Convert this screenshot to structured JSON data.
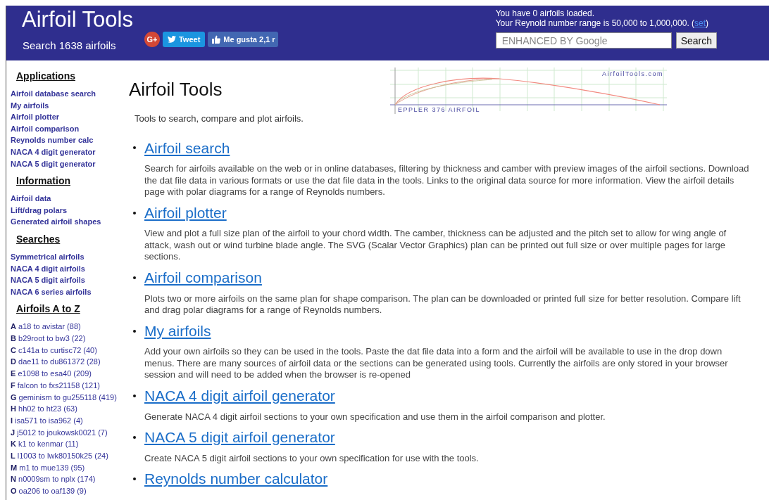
{
  "header": {
    "title": "Airfoil Tools",
    "subtitle": "Search 1638 airfoils",
    "social": [
      {
        "kind": "gplus",
        "label": "G+"
      },
      {
        "kind": "tweet",
        "label": "Tweet"
      },
      {
        "kind": "like",
        "label": "Me gusta 2,1 r"
      }
    ],
    "status_lines": [
      "You have 0 airfoils loaded.",
      "Your Reynold number range is 50,000 to 1,000,000. ("
    ],
    "status_link": "set",
    "status_end": ")",
    "search_placeholder": "ENHANCED BY Google",
    "search_button": "Search"
  },
  "sidebar": [
    {
      "heading": "Applications",
      "items": [
        {
          "label": "Airfoil database search"
        },
        {
          "label": "My airfoils"
        },
        {
          "label": "Airfoil plotter"
        },
        {
          "label": "Airfoil comparison"
        },
        {
          "label": "Reynolds number calc"
        },
        {
          "label": "NACA 4 digit generator"
        },
        {
          "label": "NACA 5 digit generator"
        }
      ]
    },
    {
      "heading": "Information",
      "items": [
        {
          "label": "Airfoil data"
        },
        {
          "label": "Lift/drag polars"
        },
        {
          "label": "Generated airfoil shapes"
        }
      ]
    },
    {
      "heading": "Searches",
      "items": [
        {
          "label": "Symmetrical airfoils"
        },
        {
          "label": "NACA 4 digit airfoils"
        },
        {
          "label": "NACA 5 digit airfoils"
        },
        {
          "label": "NACA 6 series airfoils"
        }
      ]
    },
    {
      "heading": "Airfoils A to Z",
      "az": [
        {
          "letter": "A",
          "range": "a18 to avistar (88)"
        },
        {
          "letter": "B",
          "range": "b29root to bw3 (22)"
        },
        {
          "letter": "C",
          "range": "c141a to curtisc72 (40)"
        },
        {
          "letter": "D",
          "range": "dae11 to du861372 (28)"
        },
        {
          "letter": "E",
          "range": "e1098 to esa40 (209)"
        },
        {
          "letter": "F",
          "range": "falcon to fxs21158 (121)"
        },
        {
          "letter": "G",
          "range": "geminism to gu255118 (419)"
        },
        {
          "letter": "H",
          "range": "hh02 to ht23 (63)"
        },
        {
          "letter": "I",
          "range": "isa571 to isa962 (4)"
        },
        {
          "letter": "J",
          "range": "j5012 to joukowsk0021 (7)"
        },
        {
          "letter": "K",
          "range": "k1 to kenmar (11)"
        },
        {
          "letter": "L",
          "range": "l1003 to lwk80150k25 (24)"
        },
        {
          "letter": "M",
          "range": "m1 to mue139 (95)"
        },
        {
          "letter": "N",
          "range": "n0009sm to nplx (174)"
        },
        {
          "letter": "O",
          "range": "oa206 to oaf139 (9)"
        }
      ]
    }
  ],
  "main": {
    "title": "Airfoil Tools",
    "intro": "Tools to search, compare and plot airfoils.",
    "plot": {
      "site": "AirfoilTools.com",
      "caption": "EPPLER 376  AIRFOIL"
    },
    "sections": [
      {
        "link": "Airfoil search",
        "text": "Search for airfoils available on the web or in online databases, filtering by thickness and camber with preview images of the airfoil sections. Download the dat file data in various formats or use the dat file data in the tools. Links to the original data source for more information. View the airfoil details page with polar diagrams for a range of Reynolds numbers."
      },
      {
        "link": "Airfoil plotter",
        "text": "View and plot a full size plan of the airfoil to your chord width. The camber, thickness can be adjusted and the pitch set to allow for wing angle of attack, wash out or wind turbine blade angle. The SVG (Scalar Vector Graphics) plan can be printed out full size or over multiple pages for large sections."
      },
      {
        "link": "Airfoil comparison",
        "text": "Plots two or more airfoils on the same plan for shape comparison. The plan can be downloaded or printed full size for better resolution. Compare lift and drag polar diagrams for a range of Reynolds numbers."
      },
      {
        "link": "My airfoils",
        "text": "Add your own airfoils so they can be used in the tools. Paste the dat file data into a form and the airfoil will be available to use in the drop down menus. There are many sources of airfoil data or the sections can be generated using tools. Currently the airfoils are only stored in your browser session and will need to be added when the browser is re-opened"
      },
      {
        "link": "NACA 4 digit airfoil generator",
        "text": "Generate NACA 4 digit airfoil sections to your own specification and use them in the airfoil comparison and plotter."
      },
      {
        "link": "NACA 5 digit airfoil generator",
        "text": "Create NACA 5 digit airfoil sections to your own specification for use with the tools."
      },
      {
        "link": "Reynolds number calculator"
      }
    ]
  }
}
